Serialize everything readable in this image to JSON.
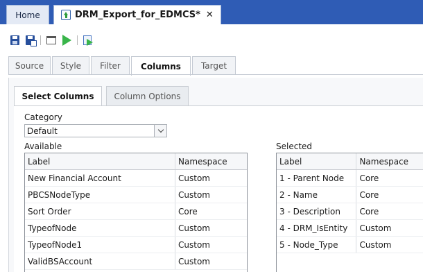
{
  "doc_tabs": {
    "home_label": "Home",
    "active_label": "DRM_Export_for_EDMCS*",
    "close_glyph": "✕"
  },
  "toolbar": {
    "icons": [
      "save-icon",
      "save-as-icon",
      "window-icon",
      "run-icon",
      "export-icon"
    ]
  },
  "section_tabs": [
    "Source",
    "Style",
    "Filter",
    "Columns",
    "Target"
  ],
  "active_section_tab": "Columns",
  "sub_tabs": [
    "Select Columns",
    "Column Options"
  ],
  "active_sub_tab": "Select Columns",
  "category": {
    "label": "Category",
    "value": "Default"
  },
  "available": {
    "label": "Available",
    "columns": [
      "Label",
      "Namespace"
    ],
    "rows": [
      [
        "New Financial Account",
        "Custom"
      ],
      [
        "PBCSNodeType",
        "Custom"
      ],
      [
        "Sort Order",
        "Core"
      ],
      [
        "TypeofNode",
        "Custom"
      ],
      [
        "TypeofNode1",
        "Custom"
      ],
      [
        "ValidBSAccount",
        "Custom"
      ]
    ]
  },
  "selected": {
    "label": "Selected",
    "columns": [
      "Label",
      "Namespace"
    ],
    "rows": [
      [
        "1 - Parent Node",
        "Core"
      ],
      [
        "2 - Name",
        "Core"
      ],
      [
        "3 - Description",
        "Core"
      ],
      [
        "4 - DRM_IsEntity",
        "Custom"
      ],
      [
        "5 - Node_Type",
        "Custom"
      ]
    ]
  },
  "colors": {
    "tabbar_blue": "#2f5cb5",
    "run_green": "#39b54a",
    "save_blue": "#274f9c"
  }
}
